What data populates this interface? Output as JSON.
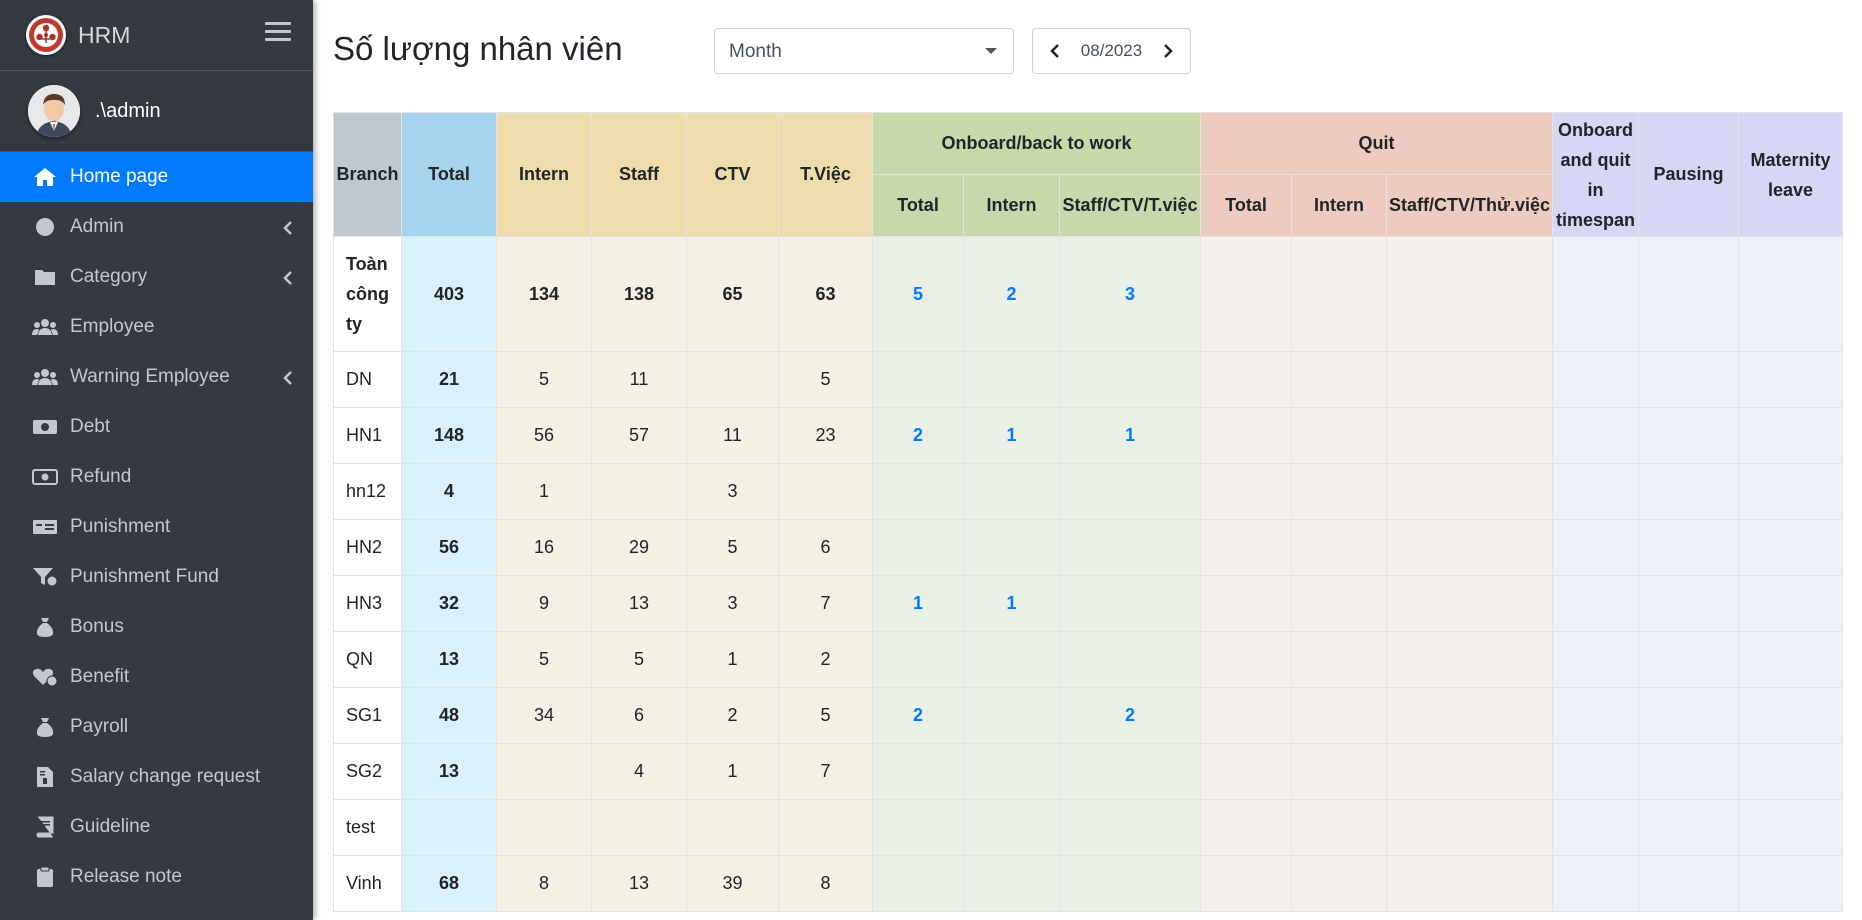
{
  "brand": {
    "name": "HRM"
  },
  "user": {
    "name": ".\\admin"
  },
  "sidebar": {
    "items": [
      {
        "label": "Home page",
        "icon": "home-icon",
        "active": true,
        "caret": false
      },
      {
        "label": "Admin",
        "icon": "circle-icon",
        "active": false,
        "caret": true
      },
      {
        "label": "Category",
        "icon": "folder-icon",
        "active": false,
        "caret": true
      },
      {
        "label": "Employee",
        "icon": "users-icon",
        "active": false,
        "caret": false
      },
      {
        "label": "Warning Employee",
        "icon": "users-icon",
        "active": false,
        "caret": true
      },
      {
        "label": "Debt",
        "icon": "money-icon",
        "active": false,
        "caret": false
      },
      {
        "label": "Refund",
        "icon": "money-bill-icon",
        "active": false,
        "caret": false
      },
      {
        "label": "Punishment",
        "icon": "money-check-icon",
        "active": false,
        "caret": false
      },
      {
        "label": "Punishment Fund",
        "icon": "funnel-dollar-icon",
        "active": false,
        "caret": false
      },
      {
        "label": "Bonus",
        "icon": "money-bag-icon",
        "active": false,
        "caret": false
      },
      {
        "label": "Benefit",
        "icon": "heart-check-icon",
        "active": false,
        "caret": false
      },
      {
        "label": "Payroll",
        "icon": "money-bag-icon",
        "active": false,
        "caret": false
      },
      {
        "label": "Salary change request",
        "icon": "file-invoice-dollar-icon",
        "active": false,
        "caret": false
      },
      {
        "label": "Guideline",
        "icon": "book-icon",
        "active": false,
        "caret": false
      },
      {
        "label": "Release note",
        "icon": "clipboard-icon",
        "active": false,
        "caret": false
      }
    ]
  },
  "header": {
    "title": "Số lượng nhân viên",
    "period_select": "Month",
    "month": "08/2023"
  },
  "table": {
    "headers": {
      "branch": "Branch",
      "total": "Total",
      "intern": "Intern",
      "staff": "Staff",
      "ctv": "CTV",
      "tviec": "T.Việc",
      "onboard_group": "Onboard/back to work",
      "quit_group": "Quit",
      "onboard_quit": "Onboard and quit in timespan",
      "pausing": "Pausing",
      "maternity": "Maternity leave",
      "sub_total": "Total",
      "sub_intern": "Intern",
      "sub_onboard_staff": "Staff/CTV/T.việc",
      "sub_quit_staff": "Staff/CTV/Thử.việc"
    },
    "rows": [
      {
        "branch": "Toàn công ty",
        "total": "403",
        "intern": "134",
        "staff": "138",
        "ctv": "65",
        "tviec": "63",
        "on_total": "5",
        "on_intern": "2",
        "on_staff": "3",
        "quit_total": "",
        "quit_intern": "",
        "quit_staff": "",
        "onquit": "",
        "pausing": "",
        "maternity": ""
      },
      {
        "branch": "DN",
        "total": "21",
        "intern": "5",
        "staff": "11",
        "ctv": "",
        "tviec": "5",
        "on_total": "",
        "on_intern": "",
        "on_staff": "",
        "quit_total": "",
        "quit_intern": "",
        "quit_staff": "",
        "onquit": "",
        "pausing": "",
        "maternity": ""
      },
      {
        "branch": "HN1",
        "total": "148",
        "intern": "56",
        "staff": "57",
        "ctv": "11",
        "tviec": "23",
        "on_total": "2",
        "on_intern": "1",
        "on_staff": "1",
        "quit_total": "",
        "quit_intern": "",
        "quit_staff": "",
        "onquit": "",
        "pausing": "",
        "maternity": ""
      },
      {
        "branch": "hn12",
        "total": "4",
        "intern": "1",
        "staff": "",
        "ctv": "3",
        "tviec": "",
        "on_total": "",
        "on_intern": "",
        "on_staff": "",
        "quit_total": "",
        "quit_intern": "",
        "quit_staff": "",
        "onquit": "",
        "pausing": "",
        "maternity": ""
      },
      {
        "branch": "HN2",
        "total": "56",
        "intern": "16",
        "staff": "29",
        "ctv": "5",
        "tviec": "6",
        "on_total": "",
        "on_intern": "",
        "on_staff": "",
        "quit_total": "",
        "quit_intern": "",
        "quit_staff": "",
        "onquit": "",
        "pausing": "",
        "maternity": ""
      },
      {
        "branch": "HN3",
        "total": "32",
        "intern": "9",
        "staff": "13",
        "ctv": "3",
        "tviec": "7",
        "on_total": "1",
        "on_intern": "1",
        "on_staff": "",
        "quit_total": "",
        "quit_intern": "",
        "quit_staff": "",
        "onquit": "",
        "pausing": "",
        "maternity": ""
      },
      {
        "branch": "QN",
        "total": "13",
        "intern": "5",
        "staff": "5",
        "ctv": "1",
        "tviec": "2",
        "on_total": "",
        "on_intern": "",
        "on_staff": "",
        "quit_total": "",
        "quit_intern": "",
        "quit_staff": "",
        "onquit": "",
        "pausing": "",
        "maternity": ""
      },
      {
        "branch": "SG1",
        "total": "48",
        "intern": "34",
        "staff": "6",
        "ctv": "2",
        "tviec": "5",
        "on_total": "2",
        "on_intern": "",
        "on_staff": "2",
        "quit_total": "",
        "quit_intern": "",
        "quit_staff": "",
        "onquit": "",
        "pausing": "",
        "maternity": ""
      },
      {
        "branch": "SG2",
        "total": "13",
        "intern": "",
        "staff": "4",
        "ctv": "1",
        "tviec": "7",
        "on_total": "",
        "on_intern": "",
        "on_staff": "",
        "quit_total": "",
        "quit_intern": "",
        "quit_staff": "",
        "onquit": "",
        "pausing": "",
        "maternity": ""
      },
      {
        "branch": "test",
        "total": "",
        "intern": "",
        "staff": "",
        "ctv": "",
        "tviec": "",
        "on_total": "",
        "on_intern": "",
        "on_staff": "",
        "quit_total": "",
        "quit_intern": "",
        "quit_staff": "",
        "onquit": "",
        "pausing": "",
        "maternity": ""
      },
      {
        "branch": "Vinh",
        "total": "68",
        "intern": "8",
        "staff": "13",
        "ctv": "39",
        "tviec": "8",
        "on_total": "",
        "on_intern": "",
        "on_staff": "",
        "quit_total": "",
        "quit_intern": "",
        "quit_staff": "",
        "onquit": "",
        "pausing": "",
        "maternity": ""
      }
    ]
  },
  "colors": {
    "sidebar_bg": "#343a40",
    "active_item": "#007bff",
    "link_blue": "#007bff"
  }
}
